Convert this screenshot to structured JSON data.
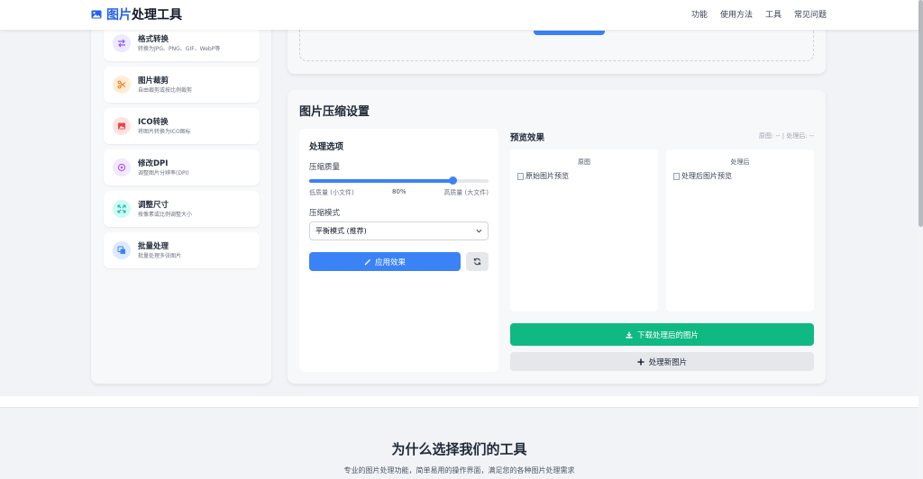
{
  "header": {
    "logo_accent": "图片",
    "logo_rest": "处理工具",
    "nav": [
      "功能",
      "使用方法",
      "工具",
      "常见问题"
    ]
  },
  "sidebar": {
    "items": [
      {
        "title": "格式转换",
        "desc": "转换为JPG、PNG、GIF、WebP等",
        "icon": "swap-icon",
        "color": "#8b5cf6",
        "bg": "#ede9fe"
      },
      {
        "title": "图片裁剪",
        "desc": "自由裁剪或按比例裁剪",
        "icon": "scissors-icon",
        "color": "#f97316",
        "bg": "#ffedd5"
      },
      {
        "title": "ICO转换",
        "desc": "将图片转换为ICO图标",
        "icon": "image-icon",
        "color": "#ef4444",
        "bg": "#fee2e2"
      },
      {
        "title": "修改DPI",
        "desc": "调整图片分辨率(DPI)",
        "icon": "target-icon",
        "color": "#a855f7",
        "bg": "#f3e8ff"
      },
      {
        "title": "调整尺寸",
        "desc": "按像素或比例调整大小",
        "icon": "expand-icon",
        "color": "#14b8a6",
        "bg": "#ccfbf1"
      },
      {
        "title": "批量处理",
        "desc": "批量处理多张图片",
        "icon": "copy-icon",
        "color": "#3b82f6",
        "bg": "#dbeafe"
      }
    ]
  },
  "settings": {
    "title": "图片压缩设置",
    "options_title": "处理选项",
    "quality_label": "压缩质量",
    "quality_value": 80,
    "quality_value_text": "80%",
    "quality_min_label": "低质量 (小文件)",
    "quality_max_label": "高质量 (大文件)",
    "mode_label": "压缩模式",
    "mode_selected": "平衡模式 (推荐)",
    "apply_label": "应用效果",
    "preview_title": "预览效果",
    "preview_info": "原图: -- | 处理后: --",
    "original_caption": "原图",
    "processed_caption": "处理后",
    "original_alt": "原始图片预览",
    "processed_alt": "处理后图片预览",
    "download_label": "下载处理后的图片",
    "new_label": "处理新图片"
  },
  "why": {
    "title": "为什么选择我们的工具",
    "subtitle": "专业的图片处理功能，简单易用的操作界面，满足您的各种图片处理需求"
  },
  "colors": {
    "primary": "#3b82f6",
    "success": "#10b981",
    "brand": "#2563eb"
  }
}
